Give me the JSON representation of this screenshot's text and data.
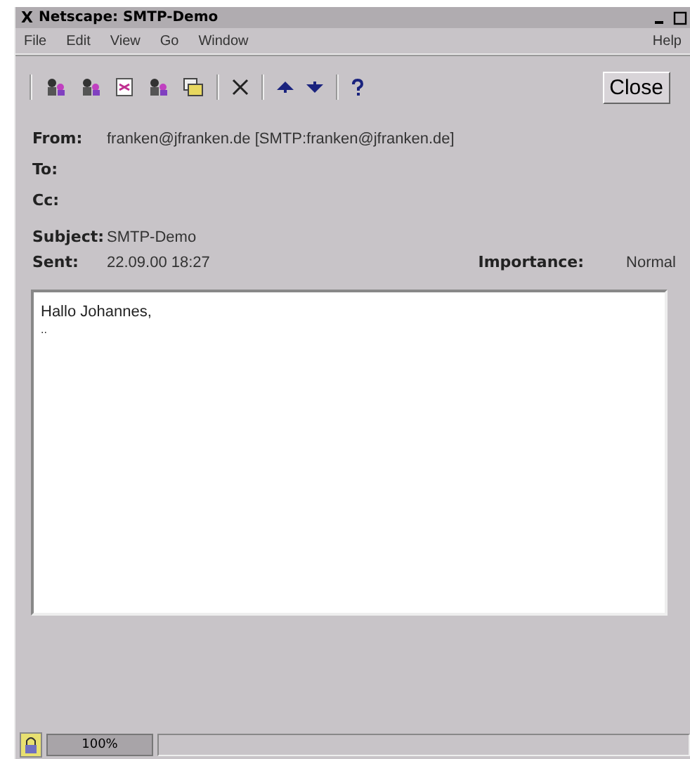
{
  "window": {
    "title": "Netscape: SMTP-Demo",
    "close_glyph": "X"
  },
  "menu": [
    "File",
    "Edit",
    "View",
    "Go",
    "Window"
  ],
  "help_menu": "Help",
  "toolbar": [
    {
      "kind": "people"
    },
    {
      "kind": "people"
    },
    {
      "kind": "doc"
    },
    {
      "kind": "people"
    },
    {
      "kind": "folder"
    },
    {
      "kind": "sep"
    },
    {
      "kind": "x"
    },
    {
      "kind": "sep"
    },
    {
      "kind": "up"
    },
    {
      "kind": "down"
    },
    {
      "kind": "sep"
    },
    {
      "kind": "help"
    }
  ],
  "close_button": "Close",
  "headers": [
    {
      "label": "From:",
      "value": "franken@jfranken.de [SMTP:franken@jfranken.de]"
    },
    {
      "label": "To:"
    },
    {
      "label": "Cc:"
    },
    {
      "label": "Subject:",
      "value": "SMTP-Demo"
    },
    {
      "label": "Sent:",
      "value": "22.09.00 18:27"
    }
  ],
  "importance": {
    "label": "Importance:",
    "value": "Normal"
  },
  "body": [
    "Hallo Johannes,",
    ".."
  ],
  "status_bar": {
    "zoom": "100%"
  }
}
